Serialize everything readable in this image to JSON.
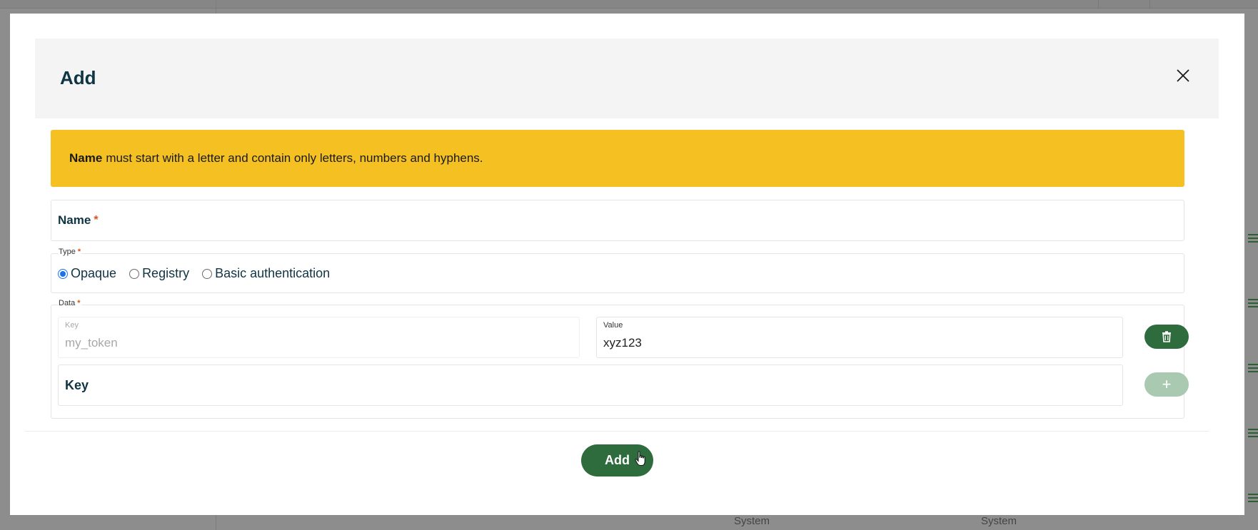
{
  "modal": {
    "title": "Add",
    "banner": {
      "bold": "Name",
      "text": "must start with a letter and contain only letters, numbers and hyphens."
    },
    "name_field": {
      "label": "Name",
      "required_mark": "*"
    },
    "type_group": {
      "legend": "Type",
      "required_mark": "*",
      "options": [
        "Opaque",
        "Registry",
        "Basic authentication"
      ],
      "selected": "Opaque"
    },
    "data_group": {
      "legend": "Data",
      "required_mark": "*",
      "rows": [
        {
          "key_label": "Key",
          "key_value": "my_token",
          "value_label": "Value",
          "value_value": "xyz123"
        }
      ],
      "new_key_placeholder": "Key",
      "add_row_symbol": "+"
    },
    "submit_label": "Add"
  },
  "background": {
    "footer_texts": [
      "System",
      "System"
    ]
  },
  "colors": {
    "primary_green": "#2e6b3d",
    "disabled_green": "#a9c9b0",
    "warning_yellow": "#f5c022",
    "heading_navy": "#0f3443",
    "required_red": "#d9531e",
    "radio_blue": "#1a73e8"
  },
  "icons": {
    "close": "close-icon",
    "delete": "trash-icon",
    "add_row": "plus-icon",
    "cursor": "hand-pointer-cursor"
  }
}
